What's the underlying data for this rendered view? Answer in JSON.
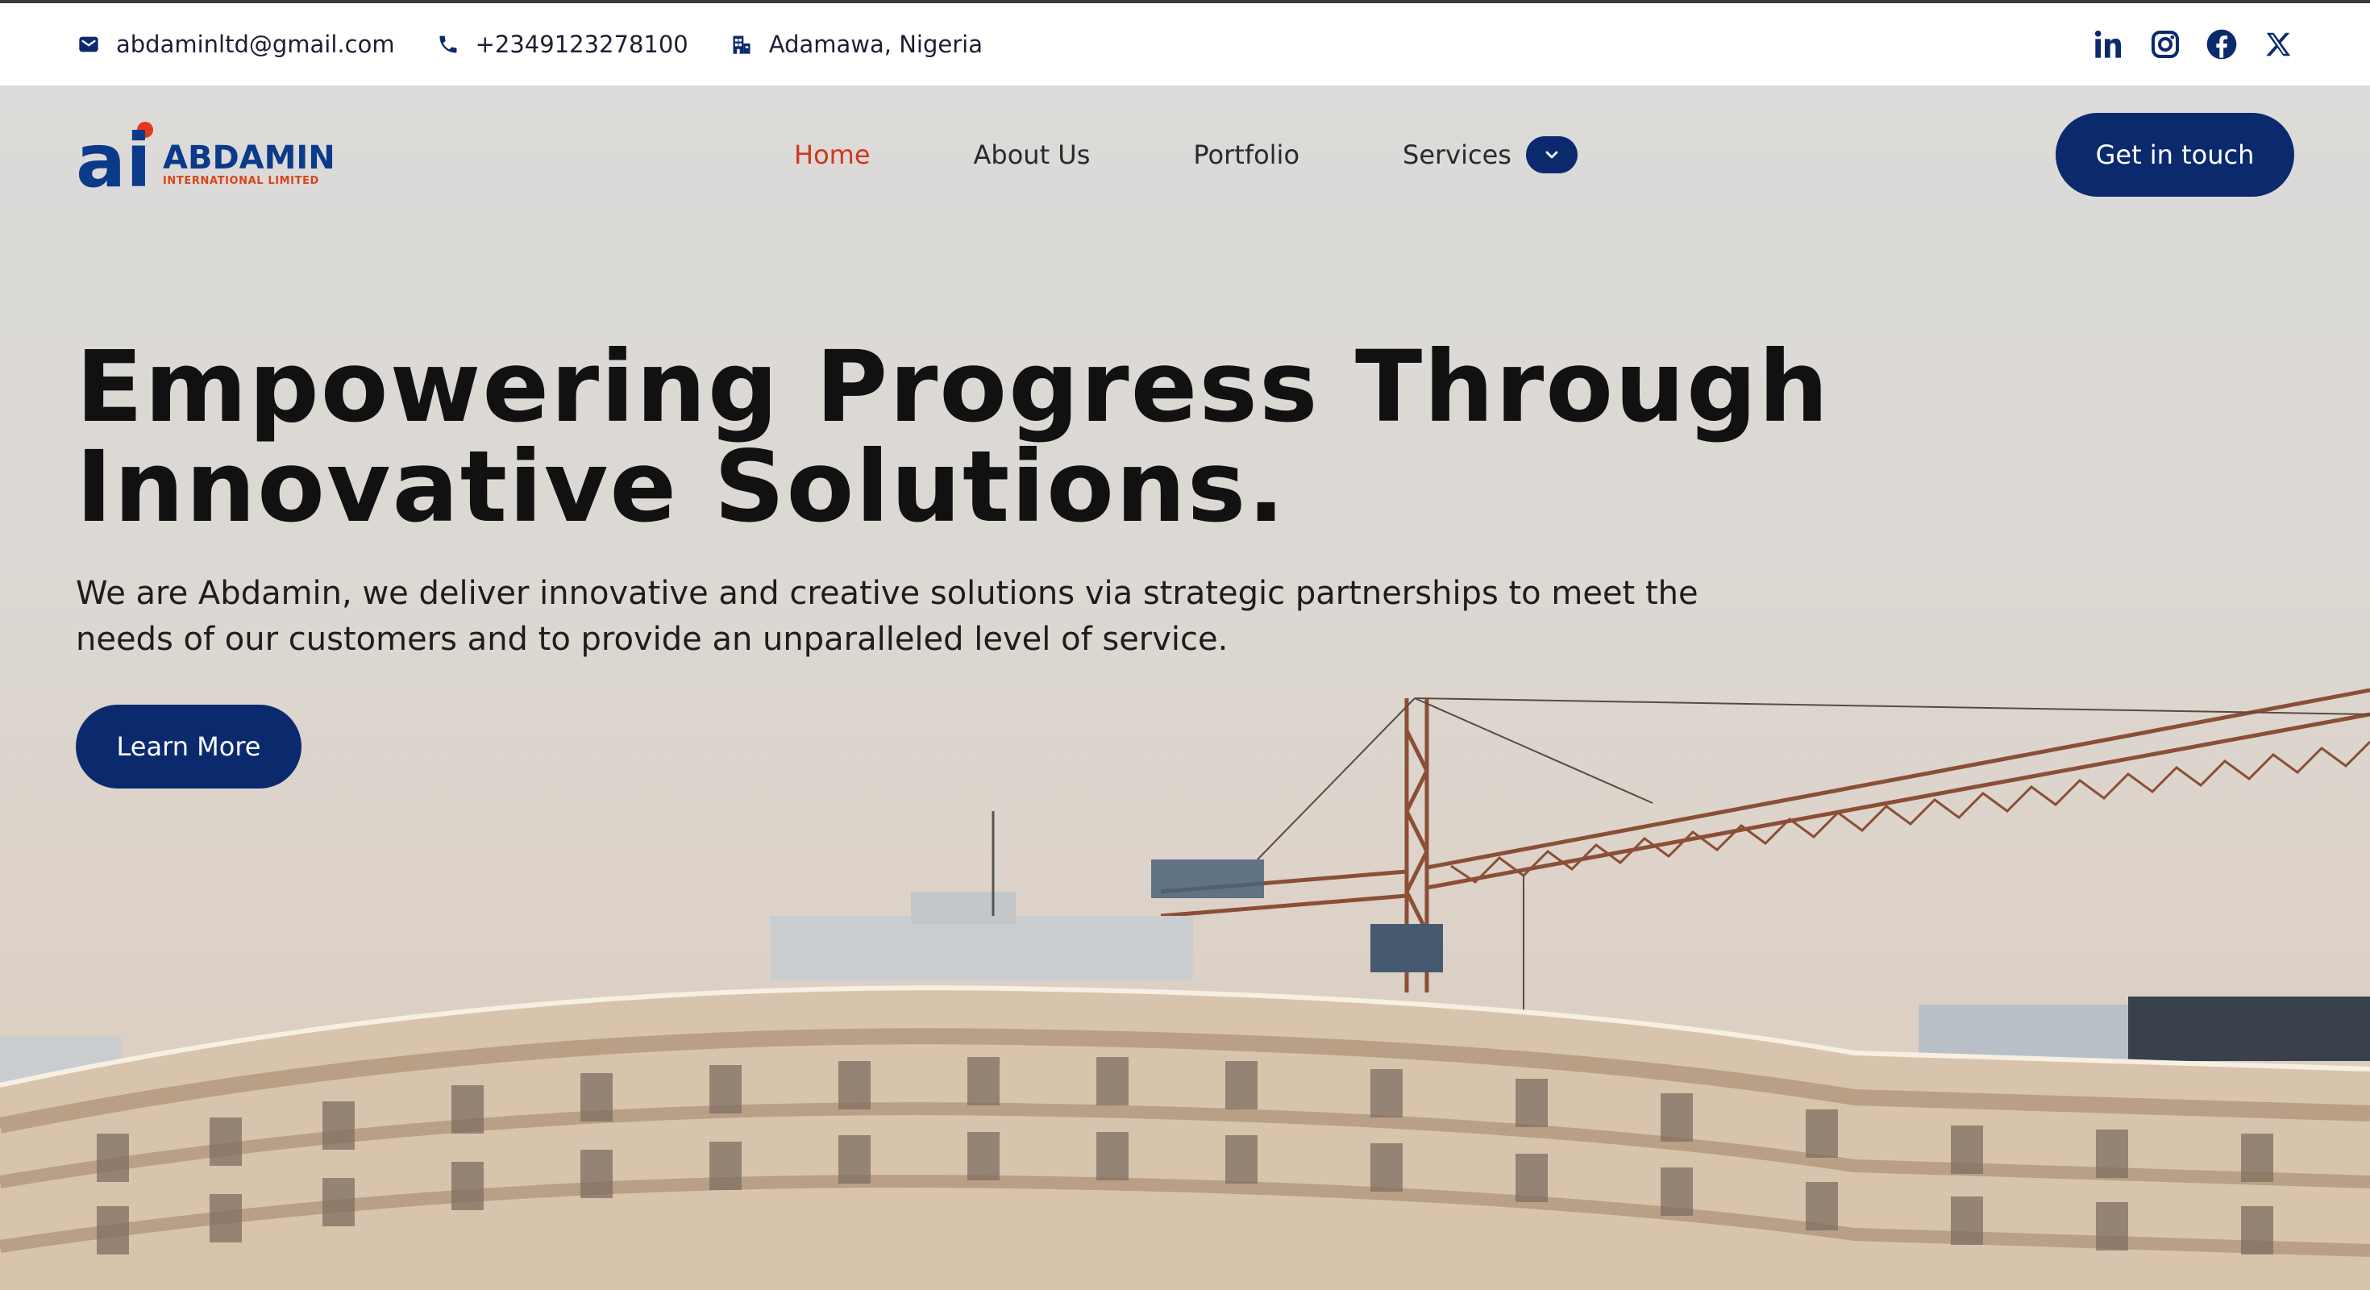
{
  "topbar": {
    "email": "abdaminltd@gmail.com",
    "phone": "+2349123278100",
    "location": "Adamawa, Nigeria",
    "socials": [
      "linkedin-icon",
      "instagram-icon",
      "facebook-icon",
      "x-icon"
    ]
  },
  "brand": {
    "mark": "ai",
    "name": "ABDAMIN",
    "sub": "INTERNATIONAL LIMITED"
  },
  "nav": {
    "items": [
      {
        "label": "Home",
        "active": true
      },
      {
        "label": "About Us",
        "active": false
      },
      {
        "label": "Portfolio",
        "active": false
      },
      {
        "label": "Services",
        "active": false
      }
    ],
    "cta": "Get in touch"
  },
  "hero": {
    "headline": "Empowering Progress Through Innovative Solutions.",
    "subtext": "We are Abdamin, we deliver innovative and creative solutions via strategic partnerships to meet the needs of our customers and to provide an unparalleled level of service.",
    "button": "Learn More"
  },
  "colors": {
    "primary": "#0b2a6e",
    "accent": "#d1361a",
    "brand_blue": "#0b3a8a"
  }
}
